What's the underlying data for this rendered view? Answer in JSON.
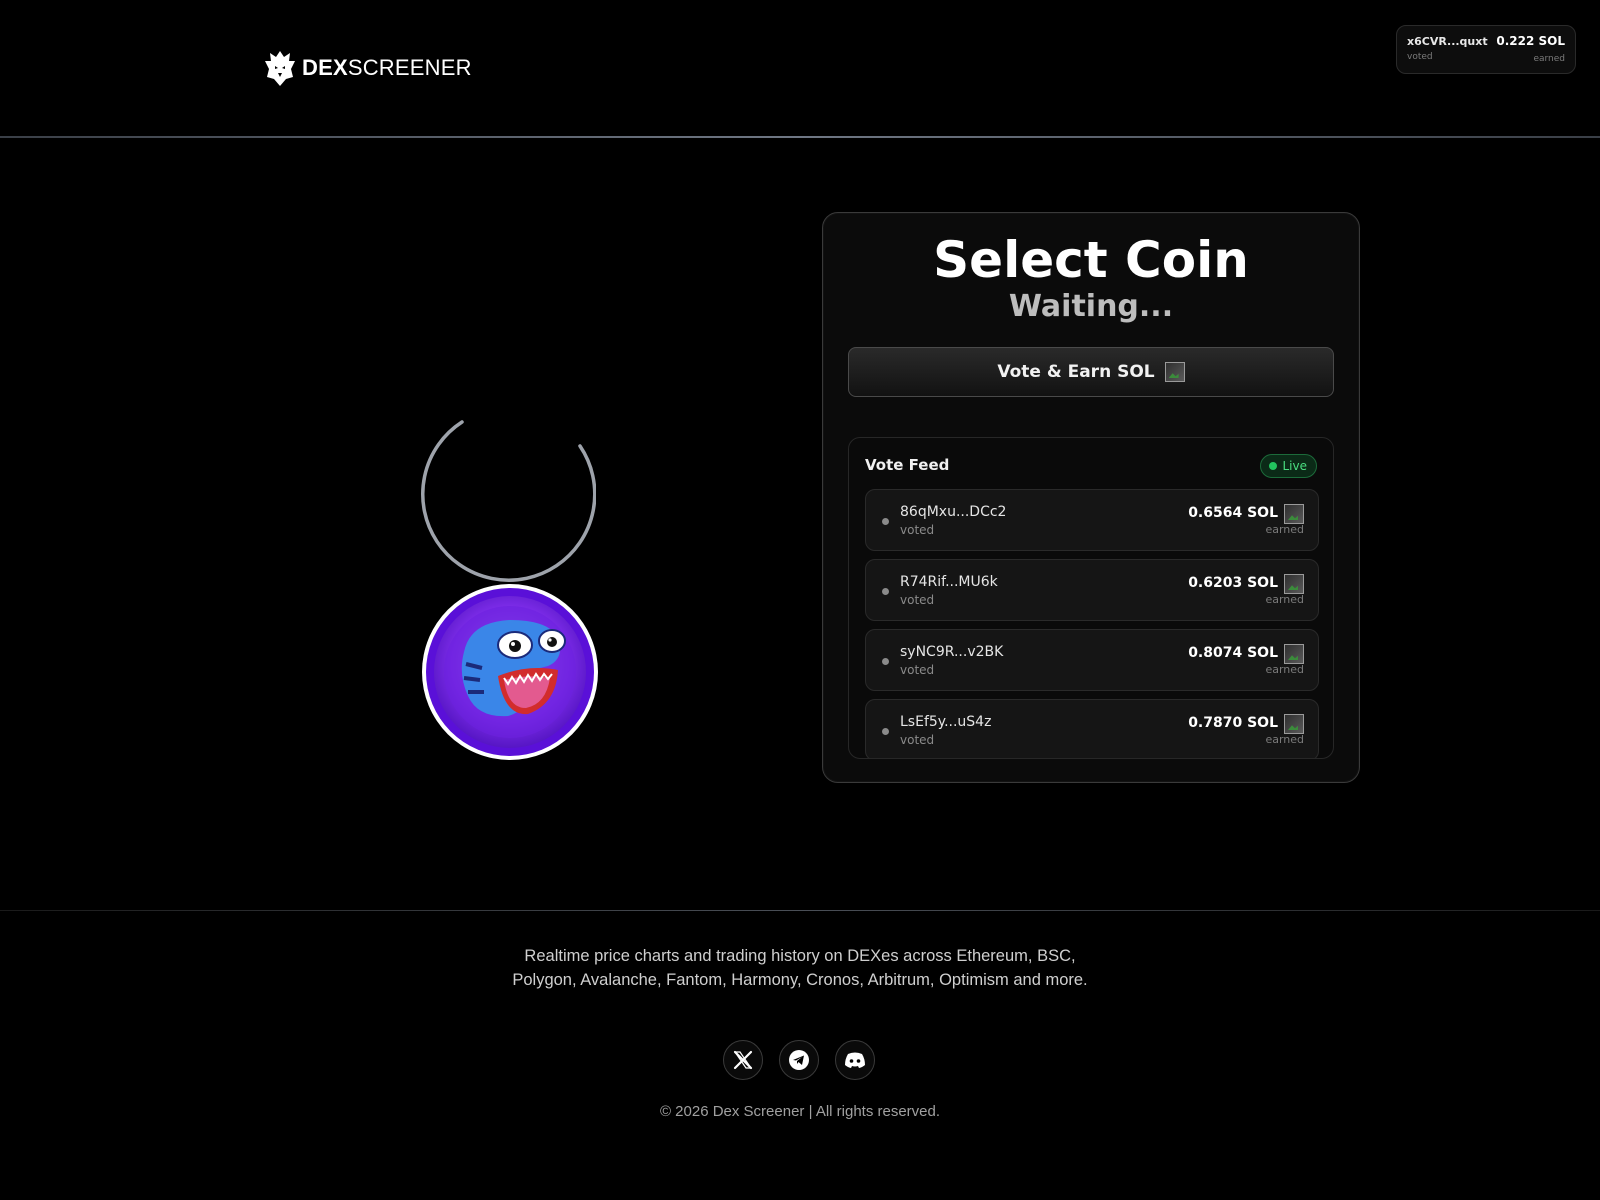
{
  "header": {
    "logo_bold": "DEX",
    "logo_light": "SCREENER",
    "mini_feed": {
      "address": "x6CVR...quxt",
      "voted": "voted",
      "amount": "0.222 SOL",
      "earned": "earned"
    }
  },
  "card": {
    "title": "Select Coin",
    "status": "Waiting...",
    "vote_button_label": "Vote & Earn SOL",
    "feed": {
      "title": "Vote Feed",
      "live_label": "Live",
      "items": [
        {
          "address": "86qMxu...DCc2",
          "voted": "voted",
          "amount": "0.6564 SOL",
          "earned": "earned"
        },
        {
          "address": "R74Rif...MU6k",
          "voted": "voted",
          "amount": "0.6203 SOL",
          "earned": "earned"
        },
        {
          "address": "syNC9R...v2BK",
          "voted": "voted",
          "amount": "0.8074 SOL",
          "earned": "earned"
        },
        {
          "address": "LsEf5y...uS4z",
          "voted": "voted",
          "amount": "0.7870 SOL",
          "earned": "earned"
        }
      ]
    }
  },
  "footer": {
    "description": "Realtime price charts and trading history on DEXes across Ethereum, BSC, Polygon, Avalanche, Fantom, Harmony, Cronos, Arbitrum, Optimism and more.",
    "copyright": "© 2026 Dex Screener | All rights reserved.",
    "socials": [
      "x-icon",
      "telegram-icon",
      "discord-icon"
    ]
  },
  "colors": {
    "background": "#000000",
    "live_green": "#22c55e",
    "coin_purple": "#7c2ae8"
  }
}
